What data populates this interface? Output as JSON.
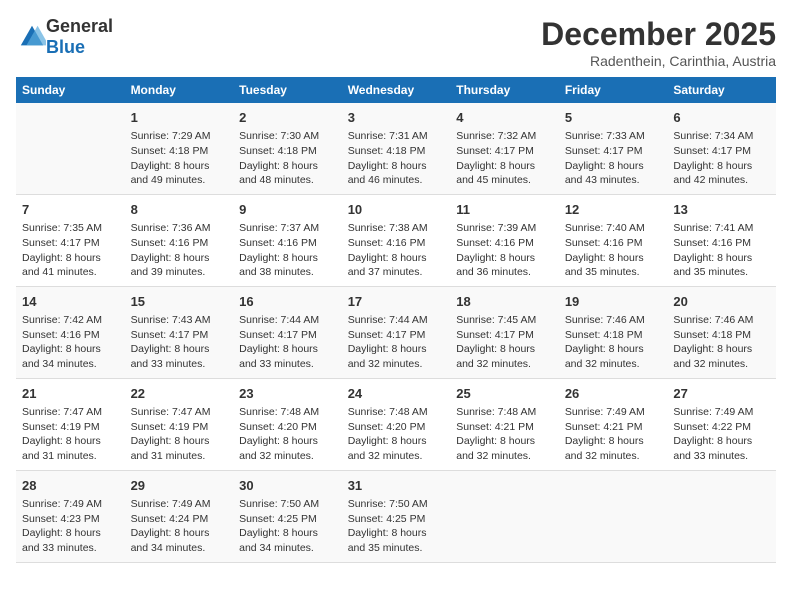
{
  "header": {
    "logo_general": "General",
    "logo_blue": "Blue",
    "month": "December 2025",
    "location": "Radenthein, Carinthia, Austria"
  },
  "weekdays": [
    "Sunday",
    "Monday",
    "Tuesday",
    "Wednesday",
    "Thursday",
    "Friday",
    "Saturday"
  ],
  "weeks": [
    [
      {
        "day": "",
        "info": ""
      },
      {
        "day": "1",
        "info": "Sunrise: 7:29 AM\nSunset: 4:18 PM\nDaylight: 8 hours\nand 49 minutes."
      },
      {
        "day": "2",
        "info": "Sunrise: 7:30 AM\nSunset: 4:18 PM\nDaylight: 8 hours\nand 48 minutes."
      },
      {
        "day": "3",
        "info": "Sunrise: 7:31 AM\nSunset: 4:18 PM\nDaylight: 8 hours\nand 46 minutes."
      },
      {
        "day": "4",
        "info": "Sunrise: 7:32 AM\nSunset: 4:17 PM\nDaylight: 8 hours\nand 45 minutes."
      },
      {
        "day": "5",
        "info": "Sunrise: 7:33 AM\nSunset: 4:17 PM\nDaylight: 8 hours\nand 43 minutes."
      },
      {
        "day": "6",
        "info": "Sunrise: 7:34 AM\nSunset: 4:17 PM\nDaylight: 8 hours\nand 42 minutes."
      }
    ],
    [
      {
        "day": "7",
        "info": "Sunrise: 7:35 AM\nSunset: 4:17 PM\nDaylight: 8 hours\nand 41 minutes."
      },
      {
        "day": "8",
        "info": "Sunrise: 7:36 AM\nSunset: 4:16 PM\nDaylight: 8 hours\nand 39 minutes."
      },
      {
        "day": "9",
        "info": "Sunrise: 7:37 AM\nSunset: 4:16 PM\nDaylight: 8 hours\nand 38 minutes."
      },
      {
        "day": "10",
        "info": "Sunrise: 7:38 AM\nSunset: 4:16 PM\nDaylight: 8 hours\nand 37 minutes."
      },
      {
        "day": "11",
        "info": "Sunrise: 7:39 AM\nSunset: 4:16 PM\nDaylight: 8 hours\nand 36 minutes."
      },
      {
        "day": "12",
        "info": "Sunrise: 7:40 AM\nSunset: 4:16 PM\nDaylight: 8 hours\nand 35 minutes."
      },
      {
        "day": "13",
        "info": "Sunrise: 7:41 AM\nSunset: 4:16 PM\nDaylight: 8 hours\nand 35 minutes."
      }
    ],
    [
      {
        "day": "14",
        "info": "Sunrise: 7:42 AM\nSunset: 4:16 PM\nDaylight: 8 hours\nand 34 minutes."
      },
      {
        "day": "15",
        "info": "Sunrise: 7:43 AM\nSunset: 4:17 PM\nDaylight: 8 hours\nand 33 minutes."
      },
      {
        "day": "16",
        "info": "Sunrise: 7:44 AM\nSunset: 4:17 PM\nDaylight: 8 hours\nand 33 minutes."
      },
      {
        "day": "17",
        "info": "Sunrise: 7:44 AM\nSunset: 4:17 PM\nDaylight: 8 hours\nand 32 minutes."
      },
      {
        "day": "18",
        "info": "Sunrise: 7:45 AM\nSunset: 4:17 PM\nDaylight: 8 hours\nand 32 minutes."
      },
      {
        "day": "19",
        "info": "Sunrise: 7:46 AM\nSunset: 4:18 PM\nDaylight: 8 hours\nand 32 minutes."
      },
      {
        "day": "20",
        "info": "Sunrise: 7:46 AM\nSunset: 4:18 PM\nDaylight: 8 hours\nand 32 minutes."
      }
    ],
    [
      {
        "day": "21",
        "info": "Sunrise: 7:47 AM\nSunset: 4:19 PM\nDaylight: 8 hours\nand 31 minutes."
      },
      {
        "day": "22",
        "info": "Sunrise: 7:47 AM\nSunset: 4:19 PM\nDaylight: 8 hours\nand 31 minutes."
      },
      {
        "day": "23",
        "info": "Sunrise: 7:48 AM\nSunset: 4:20 PM\nDaylight: 8 hours\nand 32 minutes."
      },
      {
        "day": "24",
        "info": "Sunrise: 7:48 AM\nSunset: 4:20 PM\nDaylight: 8 hours\nand 32 minutes."
      },
      {
        "day": "25",
        "info": "Sunrise: 7:48 AM\nSunset: 4:21 PM\nDaylight: 8 hours\nand 32 minutes."
      },
      {
        "day": "26",
        "info": "Sunrise: 7:49 AM\nSunset: 4:21 PM\nDaylight: 8 hours\nand 32 minutes."
      },
      {
        "day": "27",
        "info": "Sunrise: 7:49 AM\nSunset: 4:22 PM\nDaylight: 8 hours\nand 33 minutes."
      }
    ],
    [
      {
        "day": "28",
        "info": "Sunrise: 7:49 AM\nSunset: 4:23 PM\nDaylight: 8 hours\nand 33 minutes."
      },
      {
        "day": "29",
        "info": "Sunrise: 7:49 AM\nSunset: 4:24 PM\nDaylight: 8 hours\nand 34 minutes."
      },
      {
        "day": "30",
        "info": "Sunrise: 7:50 AM\nSunset: 4:25 PM\nDaylight: 8 hours\nand 34 minutes."
      },
      {
        "day": "31",
        "info": "Sunrise: 7:50 AM\nSunset: 4:25 PM\nDaylight: 8 hours\nand 35 minutes."
      },
      {
        "day": "",
        "info": ""
      },
      {
        "day": "",
        "info": ""
      },
      {
        "day": "",
        "info": ""
      }
    ]
  ]
}
